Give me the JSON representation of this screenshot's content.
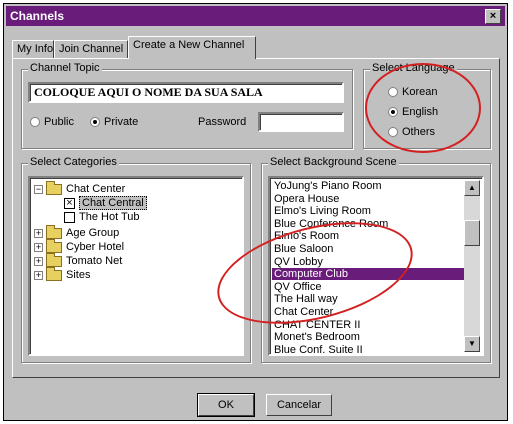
{
  "window": {
    "title": "Channels",
    "close_glyph": "×",
    "title_color": "#6a1c7a"
  },
  "tabs": [
    {
      "label": "My Info",
      "active": false
    },
    {
      "label": "Join Channel",
      "active": false
    },
    {
      "label": "Create a New Channel",
      "active": true
    }
  ],
  "channel_topic": {
    "title": "Channel Topic",
    "value": "COLOQUE AQUI O NOME DA SUA SALA",
    "public_label": "Public",
    "private_label": "Private",
    "selected": "Private",
    "password_label": "Password",
    "password_value": ""
  },
  "language": {
    "title": "Select Language",
    "options": [
      "Korean",
      "English",
      "Others"
    ],
    "selected": "English"
  },
  "categories": {
    "title": "Select Categories",
    "items": [
      {
        "label": "Chat Center",
        "expander": "−",
        "icon": "folder-icon"
      },
      {
        "label": "Chat Central",
        "checked": true,
        "selected": true
      },
      {
        "label": "The Hot Tub",
        "checked": false
      },
      {
        "label": "Age Group",
        "expander": "+",
        "icon": "folder-icon"
      },
      {
        "label": "Cyber Hotel",
        "expander": "+",
        "icon": "folder-icon"
      },
      {
        "label": "Tomato Net",
        "expander": "+",
        "icon": "folder-icon"
      },
      {
        "label": "Sites",
        "expander": "+",
        "icon": "folder-icon"
      }
    ],
    "check_glyph": "×"
  },
  "background": {
    "title": "Select Background Scene",
    "items": [
      "YoJung's Piano Room",
      "Opera House",
      "Elmo's Living Room",
      "Blue Conference Room",
      "Elmo's Room",
      "Blue Saloon",
      "QV Lobby",
      "Computer Club",
      "QV Office",
      "The Hall way",
      "Chat Center",
      "CHAT CENTER II",
      "Monet's Bedroom",
      "Blue Conf. Suite II"
    ],
    "selected": "Computer Club",
    "scroll_up_glyph": "▲",
    "scroll_down_glyph": "▼",
    "selected_color": "#6a1c7a"
  },
  "buttons": {
    "ok": "OK",
    "cancel": "Cancelar"
  },
  "annotation_color": "#d42020"
}
